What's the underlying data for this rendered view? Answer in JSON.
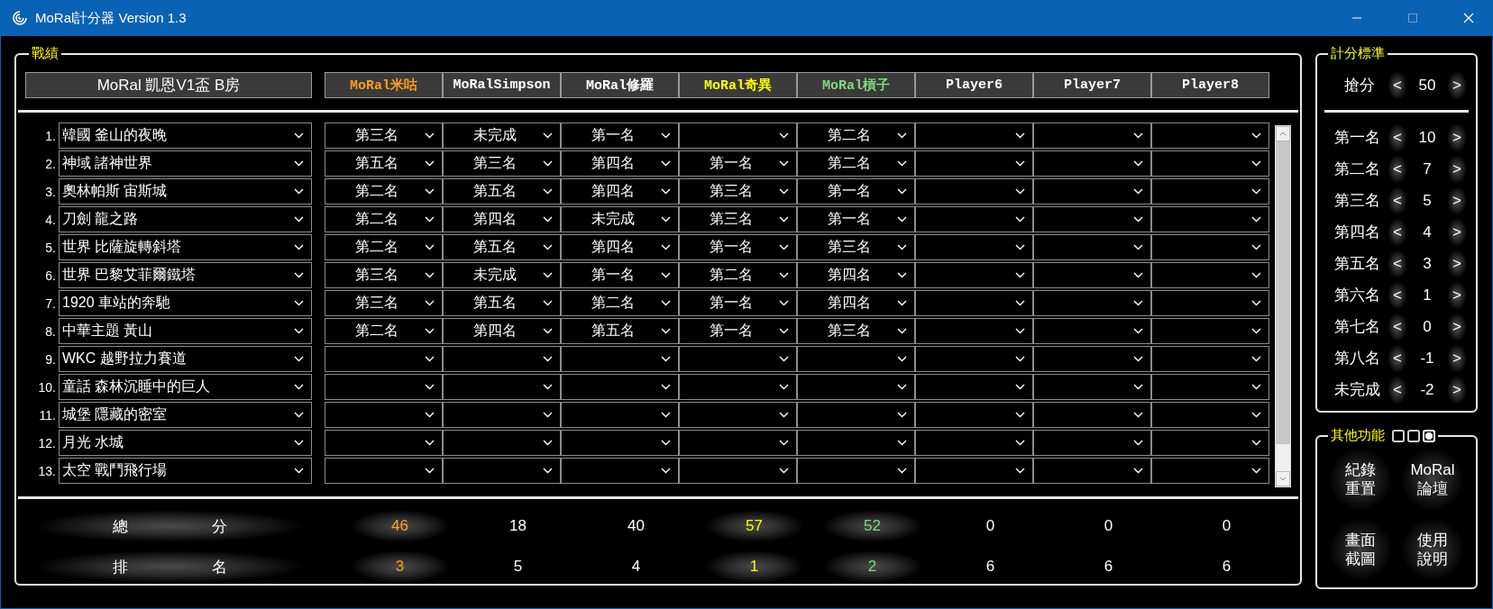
{
  "window": {
    "title": "MoRal計分器 Version 1.3"
  },
  "record": {
    "title": "戰績",
    "room": "MoRal 凱恩V1盃 B房",
    "players": [
      {
        "name": "MoRal米咕",
        "color": "#ff9d1c"
      },
      {
        "name": "MoRalSimpson",
        "color": "#ffffff"
      },
      {
        "name": "MoRal修羅",
        "color": "#ffffff"
      },
      {
        "name": "MoRal奇異",
        "color": "#ffff00"
      },
      {
        "name": "MoRal槓子",
        "color": "#7ddc7d"
      },
      {
        "name": "Player6",
        "color": "#ffffff"
      },
      {
        "name": "Player7",
        "color": "#ffffff"
      },
      {
        "name": "Player8",
        "color": "#ffffff"
      }
    ],
    "races": [
      {
        "number": "1.",
        "track": "韓國 釜山的夜晚",
        "results": [
          {
            "kind": "rank",
            "rank": "第三名"
          },
          {
            "kind": "rank",
            "rank": "未完成"
          },
          {
            "kind": "rank",
            "rank": "第一名"
          },
          {
            "kind": "blank"
          },
          {
            "kind": "rank",
            "rank": "第二名"
          }
        ]
      },
      {
        "number": "2.",
        "track": "神域 諸神世界",
        "results": [
          {
            "rank": "第五名"
          },
          {
            "rank": "第三名"
          },
          {
            "rank": "第四名"
          },
          {
            "rank": "第一名"
          },
          {
            "rank": "第二名"
          }
        ]
      },
      {
        "number": "3.",
        "track": "奧林帕斯 宙斯城",
        "results": [
          {
            "rank": "第二名"
          },
          {
            "rank": "第五名"
          },
          {
            "rank": "第四名"
          },
          {
            "rank": "第三名"
          },
          {
            "rank": "第一名"
          }
        ]
      },
      {
        "number": "4.",
        "track": "刀劍 龍之路",
        "results": [
          {
            "rank": "第二名"
          },
          {
            "rank": "第四名"
          },
          {
            "rank": "未完成"
          },
          {
            "rank": "第三名"
          },
          {
            "rank": "第一名"
          }
        ]
      },
      {
        "number": "5.",
        "track": "世界 比薩旋轉斜塔",
        "results": [
          {
            "rank": "第二名"
          },
          {
            "rank": "第五名"
          },
          {
            "rank": "第四名"
          },
          {
            "rank": "第一名"
          },
          {
            "rank": "第三名"
          }
        ]
      },
      {
        "number": "6.",
        "track": "世界 巴黎艾菲爾鐵塔",
        "results": [
          {
            "rank": "第三名"
          },
          {
            "rank": "未完成"
          },
          {
            "rank": "第一名"
          },
          {
            "rank": "第二名"
          },
          {
            "rank": "第四名"
          }
        ]
      },
      {
        "number": "7.",
        "track": "1920 車站的奔馳",
        "results": [
          {
            "rank": "第三名"
          },
          {
            "rank": "第五名"
          },
          {
            "rank": "第二名"
          },
          {
            "rank": "第一名"
          },
          {
            "rank": "第四名"
          }
        ]
      },
      {
        "number": "8.",
        "track": "中華主題 黃山",
        "results": [
          {
            "rank": "第二名"
          },
          {
            "rank": "第四名"
          },
          {
            "rank": "第五名"
          },
          {
            "rank": "第一名"
          },
          {
            "rank": "第三名"
          }
        ]
      },
      {
        "number": "9.",
        "track": "WKC 越野拉力賽道"
      },
      {
        "number": "10.",
        "track": "童話 森林沉睡中的巨人"
      },
      {
        "number": "11.",
        "track": "城堡 隱藏的密室"
      },
      {
        "number": "12.",
        "track": "月光 水城"
      },
      {
        "number": "13.",
        "track": "太空 戰鬥飛行場"
      }
    ],
    "totals": {
      "score_label": [
        "總",
        "分"
      ],
      "rank_label": [
        "排",
        "名"
      ],
      "results": [
        {
          "score": "46",
          "rank": "3",
          "highlighted": true
        },
        {
          "score": "18",
          "rank": "5",
          "highlighted": false
        },
        {
          "score": "40",
          "rank": "4",
          "highlighted": false
        },
        {
          "score": "57",
          "rank": "1",
          "highlighted": true
        },
        {
          "score": "52",
          "rank": "2",
          "highlighted": true
        },
        {
          "score": "0",
          "rank": "6",
          "highlighted": false
        },
        {
          "score": "0",
          "rank": "6",
          "highlighted": false
        },
        {
          "score": "0",
          "rank": "6",
          "highlighted": false
        }
      ]
    }
  },
  "scoring": {
    "title": "計分標準",
    "bonus": {
      "label": "搶分",
      "value": "50"
    },
    "ranks": [
      {
        "label": "第一名",
        "value": "10"
      },
      {
        "label": "第二名",
        "value": "7"
      },
      {
        "label": "第三名",
        "value": "5"
      },
      {
        "label": "第四名",
        "value": "4"
      },
      {
        "label": "第五名",
        "value": "3"
      },
      {
        "label": "第六名",
        "value": "1"
      },
      {
        "label": "第七名",
        "value": "0"
      },
      {
        "label": "第八名",
        "value": "-1"
      },
      {
        "label": "未完成",
        "value": "-2"
      }
    ],
    "decrease": "<",
    "increase": ">"
  },
  "other": {
    "title": "其他功能",
    "view_modes": [
      {
        "selected": false
      },
      {
        "selected": false
      },
      {
        "selected": true
      }
    ],
    "buttons": [
      {
        "lines": [
          "紀錄",
          "重置"
        ]
      },
      {
        "lines": [
          "MoRal",
          "論壇"
        ]
      },
      {
        "lines": [
          "畫面",
          "截圖"
        ]
      },
      {
        "lines": [
          "使用",
          "說明"
        ]
      }
    ]
  }
}
